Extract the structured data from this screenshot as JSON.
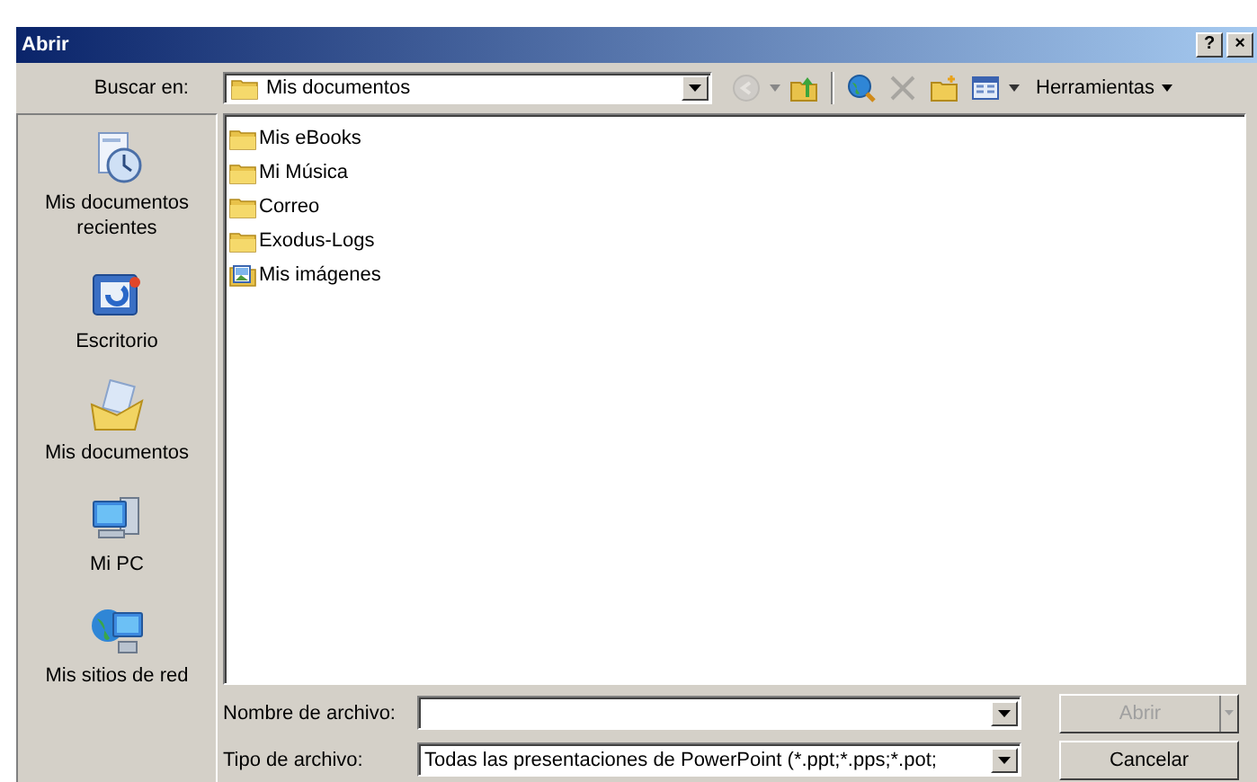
{
  "window": {
    "title": "Abrir",
    "controls": [
      "?",
      "×"
    ]
  },
  "look_in": {
    "label": "Buscar en:",
    "value": "Mis documentos"
  },
  "toolbar": [
    {
      "kind": "back",
      "disabled": true
    },
    {
      "kind": "up",
      "disabled": false
    },
    {
      "kind": "web",
      "disabled": false
    },
    {
      "kind": "delete",
      "disabled": true
    },
    {
      "kind": "newfolder",
      "disabled": false
    },
    {
      "kind": "views",
      "disabled": false
    }
  ],
  "tools_menu": {
    "label": "Herramientas"
  },
  "places": [
    {
      "label": "Mis documentos recientes",
      "kind": "recent",
      "selected": false
    },
    {
      "label": "Escritorio",
      "kind": "desktop",
      "selected": false
    },
    {
      "label": "Mis documentos",
      "kind": "documents",
      "selected": false
    },
    {
      "label": "Mi PC",
      "kind": "computer",
      "selected": false
    },
    {
      "label": "Mis sitios de red",
      "kind": "network",
      "selected": false
    }
  ],
  "files": [
    {
      "name": "Mis eBooks",
      "kind": "folder"
    },
    {
      "name": "Mi Música",
      "kind": "folder"
    },
    {
      "name": "Correo",
      "kind": "folder"
    },
    {
      "name": "Exodus-Logs",
      "kind": "folder"
    },
    {
      "name": "Mis imágenes",
      "kind": "pictures"
    }
  ],
  "file_name": {
    "label": "Nombre de archivo:"
  },
  "file_type": {
    "label": "Tipo de archivo:",
    "value": "Todas las presentaciones de PowerPoint (*.ppt;*.pps;*.pot;"
  },
  "buttons": [
    {
      "label": "Abrir",
      "disabled": true,
      "kind": "split"
    },
    {
      "label": "Cancelar",
      "disabled": false,
      "kind": "plain"
    }
  ]
}
